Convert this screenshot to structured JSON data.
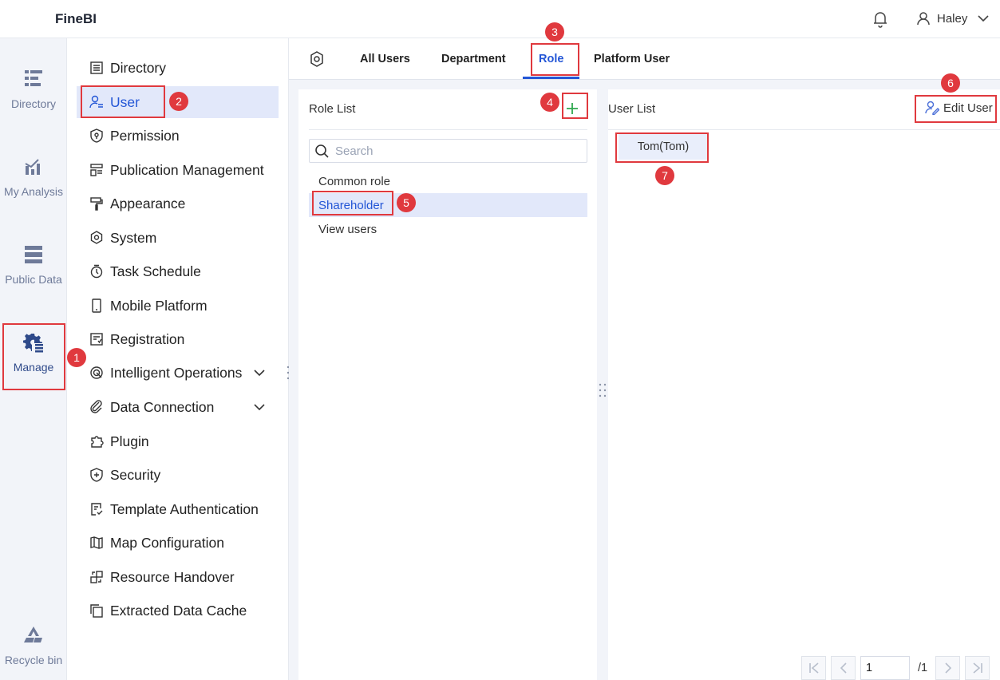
{
  "app": {
    "title": "FineBI"
  },
  "header": {
    "user_name": "Haley"
  },
  "rail": [
    {
      "label": "Directory",
      "icon": "directory-icon"
    },
    {
      "label": "My Analysis",
      "icon": "analysis-icon"
    },
    {
      "label": "Public Data",
      "icon": "public-data-icon"
    },
    {
      "label": "Manage",
      "icon": "manage-icon",
      "active": true
    },
    {
      "label": "Recycle bin",
      "icon": "recycle-bin-icon"
    }
  ],
  "nav": [
    {
      "label": "Directory",
      "icon": "list-icon"
    },
    {
      "label": "User",
      "icon": "user-list-icon",
      "active": true
    },
    {
      "label": "Permission",
      "icon": "permission-icon"
    },
    {
      "label": "Publication Management",
      "icon": "publication-icon"
    },
    {
      "label": "Appearance",
      "icon": "paint-roller-icon"
    },
    {
      "label": "System",
      "icon": "gear-icon"
    },
    {
      "label": "Task Schedule",
      "icon": "timer-icon"
    },
    {
      "label": "Mobile Platform",
      "icon": "mobile-icon"
    },
    {
      "label": "Registration",
      "icon": "registration-icon"
    },
    {
      "label": "Intelligent Operations",
      "icon": "operations-icon",
      "expandable": true
    },
    {
      "label": "Data Connection",
      "icon": "link-icon",
      "expandable": true
    },
    {
      "label": "Plugin",
      "icon": "puzzle-icon"
    },
    {
      "label": "Security",
      "icon": "shield-icon"
    },
    {
      "label": "Template Authentication",
      "icon": "template-auth-icon"
    },
    {
      "label": "Map Configuration",
      "icon": "map-icon"
    },
    {
      "label": "Resource Handover",
      "icon": "handover-icon"
    },
    {
      "label": "Extracted Data Cache",
      "icon": "cache-icon"
    }
  ],
  "tabs": {
    "items": [
      "All Users",
      "Department",
      "Role",
      "Platform User"
    ],
    "active": "Role"
  },
  "role_panel": {
    "title": "Role List",
    "add_label": "+",
    "search_placeholder": "Search",
    "roles": [
      "Common role",
      "Shareholder",
      "View users"
    ],
    "selected": "Shareholder"
  },
  "user_panel": {
    "title": "User List",
    "edit_label": "Edit User",
    "users": [
      "Tom(Tom)"
    ]
  },
  "pagination": {
    "current": "1",
    "total": "/1"
  },
  "annotations": [
    "1",
    "2",
    "3",
    "4",
    "5",
    "6",
    "7"
  ],
  "colors": {
    "accent": "#2356d6",
    "highlight": "#e0393e",
    "add": "#2fa84f"
  }
}
